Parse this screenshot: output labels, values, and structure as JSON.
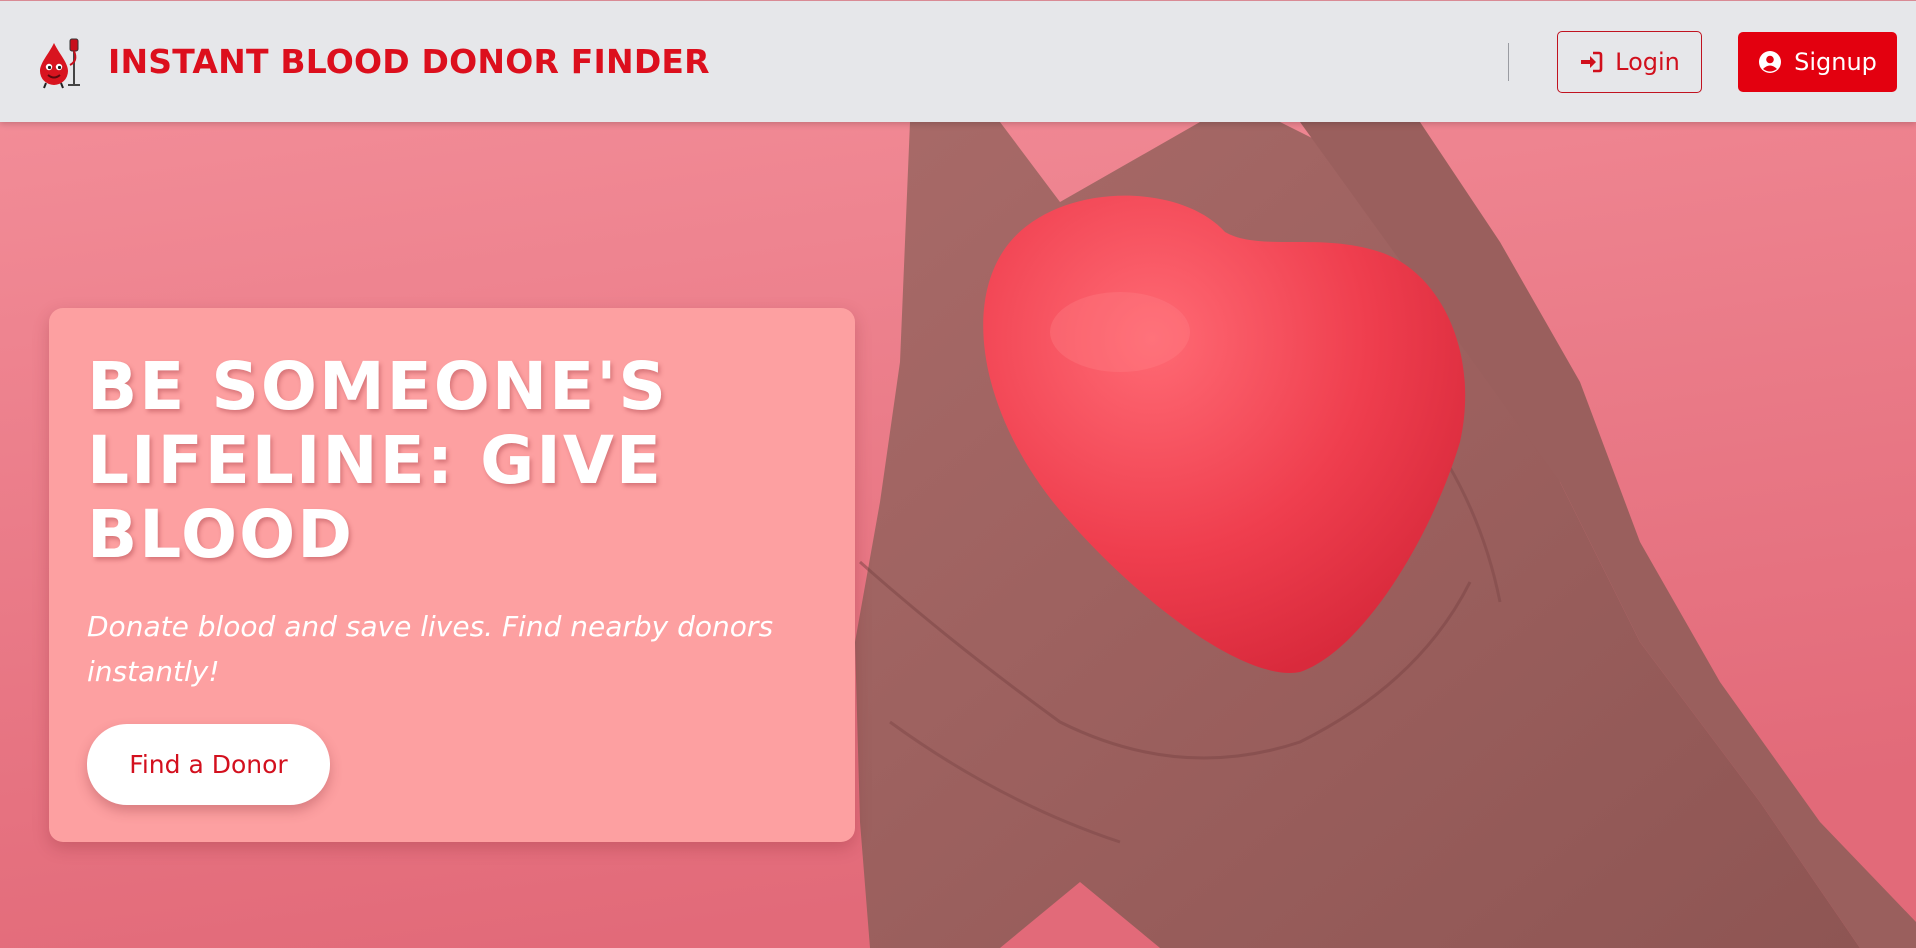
{
  "header": {
    "brand_title": "INSTANT BLOOD DONOR FINDER",
    "logo_icon": "blood-drop-mascot-icon",
    "login_label": "Login",
    "login_icon": "sign-in-icon",
    "signup_label": "Signup",
    "signup_icon": "user-circle-icon"
  },
  "hero": {
    "headline": "BE SOMEONE'S LIFELINE: GIVE BLOOD",
    "subtitle": "Donate blood and save lives. Find nearby donors instantly!",
    "cta_label": "Find a Donor",
    "image": "hands-holding-red-heart"
  },
  "colors": {
    "brand_red": "#dc0f1d",
    "navbar_bg": "#e6e7ea",
    "hero_bg": "#e97c8a",
    "card_bg": "#fda0a1",
    "heart_red": "#ef3e4e"
  }
}
